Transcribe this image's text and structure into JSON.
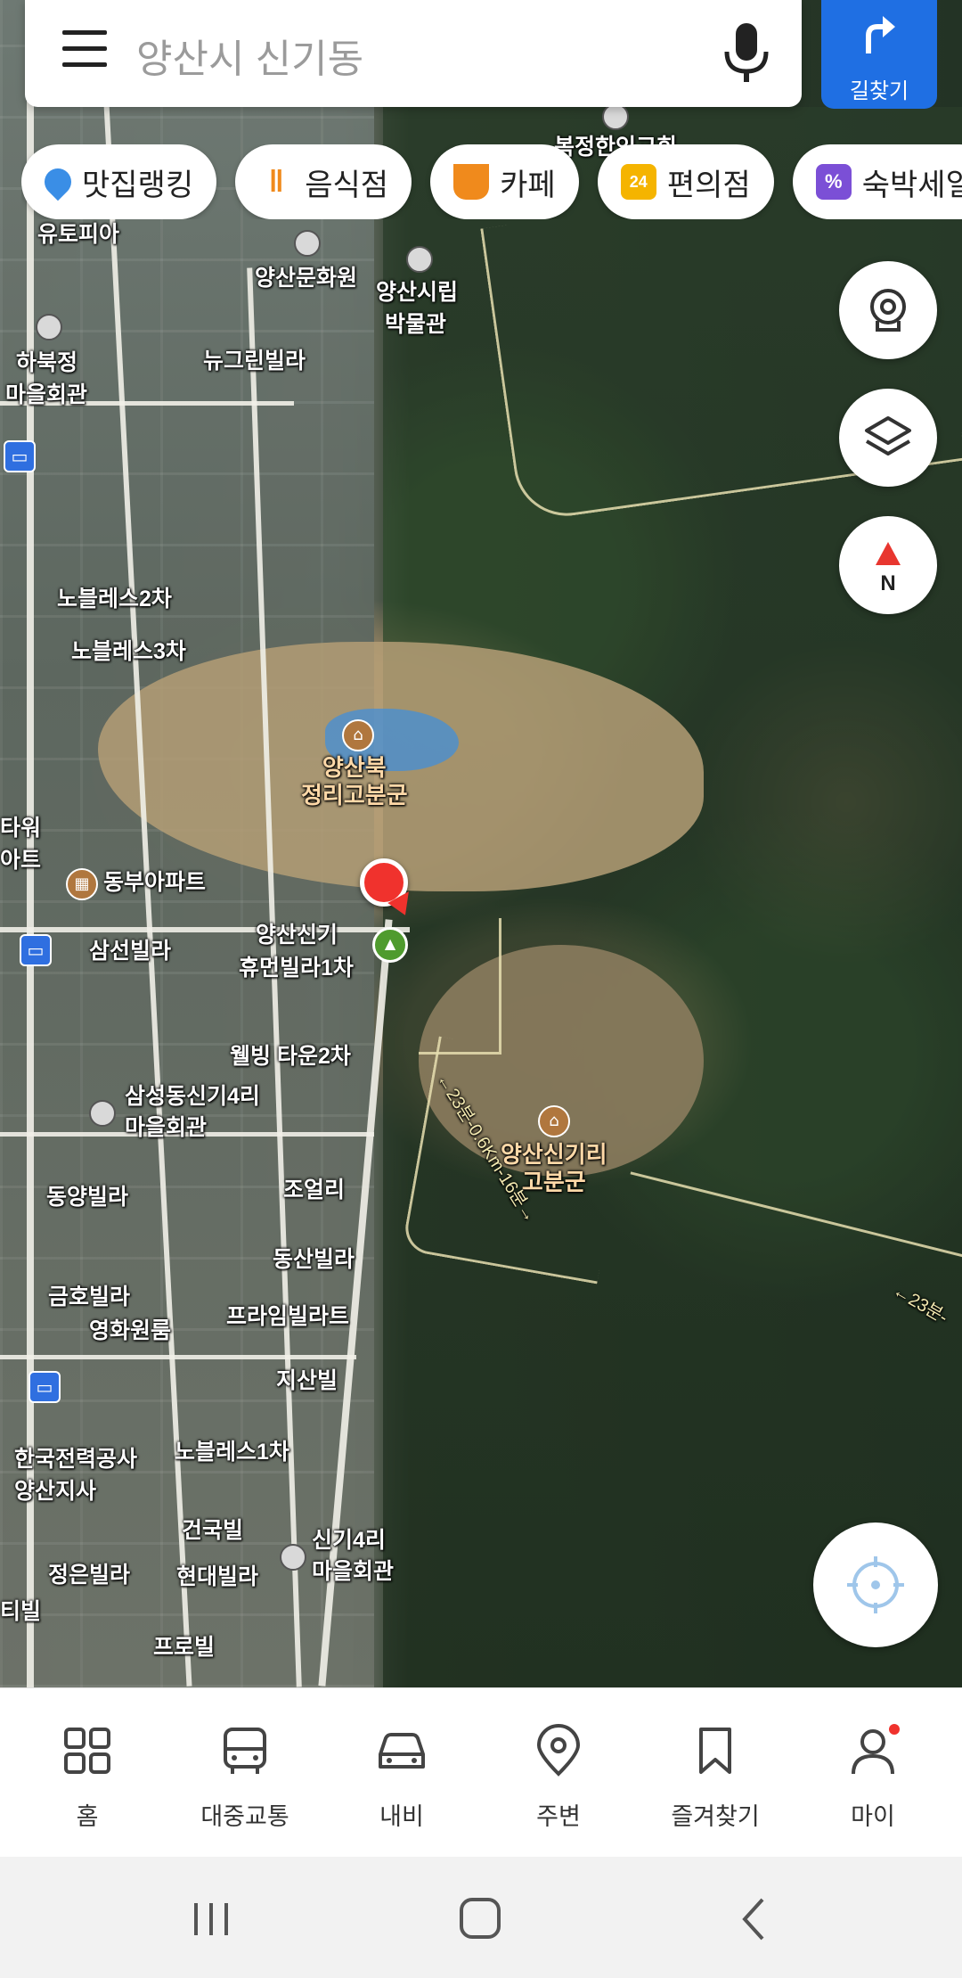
{
  "search": {
    "query": "양산시 신기동",
    "route_label": "길찾기"
  },
  "chips": [
    {
      "label": "맛집랭킹",
      "icon": "pin-laurel-icon",
      "color": "#3a8ee6"
    },
    {
      "label": "음식점",
      "icon": "fork-knife-icon",
      "color": "#f08a1c"
    },
    {
      "label": "카페",
      "icon": "coffee-cup-icon",
      "color": "#f08a1c"
    },
    {
      "label": "편의점",
      "icon": "24-store-icon",
      "color": "#f5b400"
    },
    {
      "label": "숙박세일",
      "icon": "percent-tag-icon",
      "color": "#7b4fd6"
    }
  ],
  "map": {
    "compass_label": "N",
    "labels": [
      "유토피아",
      "양산문화원",
      "양산시립",
      "박물관",
      "뉴그린빌라",
      "하북정",
      "마을회관",
      "노블레스2차",
      "노블레스3차",
      "동부아파트",
      "삼선빌라",
      "양산신기",
      "휴먼빌라1차",
      "웰빙 타운2차",
      "삼성동신기4리",
      "마을회관",
      "동양빌라",
      "조얼리",
      "동산빌라",
      "금호빌라",
      "영화원룸",
      "프라임빌라트",
      "지산빌",
      "노블레스1차",
      "한국전력공사",
      "양산지사",
      "건국빌",
      "신기4리",
      "마을회관",
      "정은빌라",
      "현대빌라",
      "프로빌",
      "타워",
      "아트",
      "티빌",
      "복정한인교회"
    ],
    "poi": [
      {
        "line1": "양산북",
        "line2": "정리고분군"
      },
      {
        "line1": "양산신기리",
        "line2": "고분군"
      }
    ],
    "trail_labels": [
      "←23분-0.6Km-16분→",
      "←23분-"
    ]
  },
  "bottom_nav": [
    {
      "label": "홈",
      "icon": "grid-icon"
    },
    {
      "label": "대중교통",
      "icon": "bus-icon"
    },
    {
      "label": "내비",
      "icon": "car-icon"
    },
    {
      "label": "주변",
      "icon": "location-pin-icon"
    },
    {
      "label": "즐겨찾기",
      "icon": "bookmark-icon"
    },
    {
      "label": "마이",
      "icon": "person-icon"
    }
  ]
}
